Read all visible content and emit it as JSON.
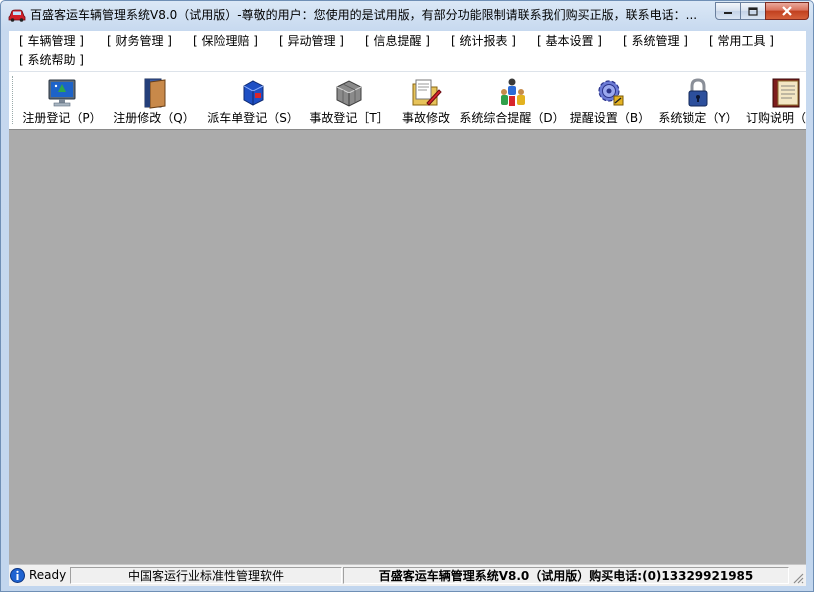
{
  "window": {
    "title": "百盛客运车辆管理系统V8.0（试用版）-尊敬的用户：您使用的是试用版，有部分功能限制请联系我们购买正版，联系电话：..."
  },
  "menu": {
    "row1": [
      "[ 车辆管理 ]",
      "[ 财务管理 ]",
      "[ 保险理赔 ]",
      "[ 异动管理 ]",
      "[ 信息提醒 ]",
      "[ 统计报表 ]",
      "[ 基本设置 ]",
      "[ 系统管理 ]",
      "[ 常用工具 ]"
    ],
    "row2": [
      "[ 系统帮助 ]"
    ]
  },
  "toolbar": {
    "buttons": [
      {
        "label": "注册登记（P）",
        "icon": "monitor-icon"
      },
      {
        "label": "注册修改（Q）",
        "icon": "book-icon"
      },
      {
        "label": "派车单登记（S）",
        "icon": "cube-dispatch-icon"
      },
      {
        "label": "事故登记［T］",
        "icon": "gray-cube-icon"
      },
      {
        "label": "事故修改",
        "icon": "folder-edit-icon"
      },
      {
        "label": "系统综合提醒（D）",
        "icon": "people-alert-icon"
      },
      {
        "label": "提醒设置（B）",
        "icon": "gear-icon"
      },
      {
        "label": "系统锁定（Y）",
        "icon": "lock-icon"
      },
      {
        "label": "订购说明（",
        "icon": "manual-book-icon"
      }
    ]
  },
  "status": {
    "ready": "Ready",
    "slogan": "中国客运行业标准性管理软件",
    "product": "百盛客运车辆管理系统V8.0（试用版）购买电话:(0)13329921985"
  },
  "colors": {
    "client_background": "#ababab",
    "titlebar_blue": "#c7d9ef",
    "close_button_red": "#c1401f"
  }
}
